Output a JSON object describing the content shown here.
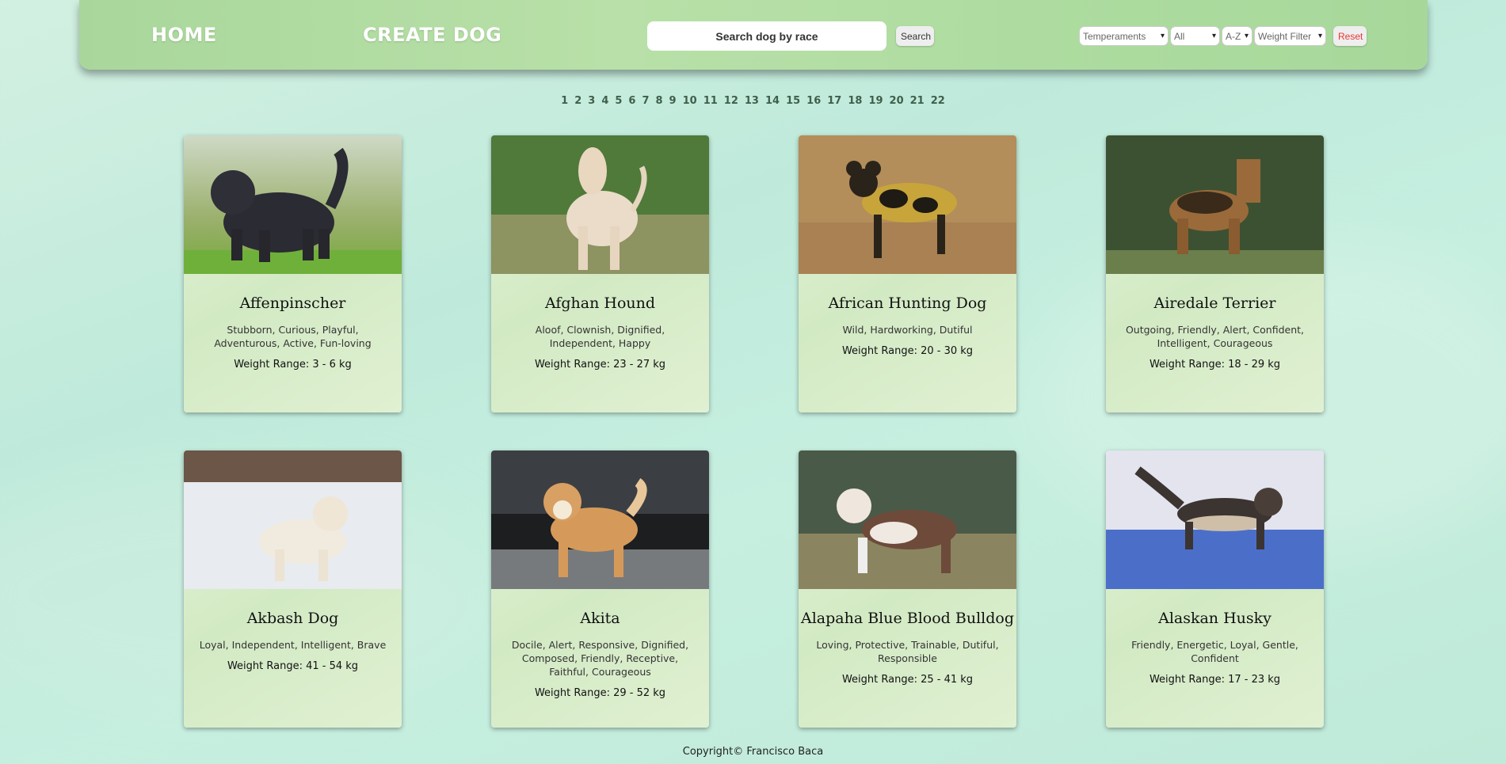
{
  "nav": {
    "home_label": "HOME",
    "create_label": "CREATE DOG",
    "search_placeholder": "Search dog by race",
    "search_button": "Search",
    "filters": {
      "temperaments": "Temperaments",
      "origin": "All",
      "order": "A-Z",
      "weight": "Weight Filter"
    },
    "reset_button": "Reset"
  },
  "pagination": [
    "1",
    "2",
    "3",
    "4",
    "5",
    "6",
    "7",
    "8",
    "9",
    "10",
    "11",
    "12",
    "13",
    "14",
    "15",
    "16",
    "17",
    "18",
    "19",
    "20",
    "21",
    "22"
  ],
  "cards": [
    {
      "name": "Affenpinscher",
      "temperaments": "Stubborn, Curious, Playful, Adventurous, Active, Fun-loving",
      "weight": "Weight Range: 3 - 6 kg",
      "photo": "black shaggy small dog on grass"
    },
    {
      "name": "Afghan Hound",
      "temperaments": "Aloof, Clownish, Dignified, Independent, Happy",
      "weight": "Weight Range: 23 - 27 kg",
      "photo": "long-haired cream hound on grass"
    },
    {
      "name": "African Hunting Dog",
      "temperaments": "Wild, Hardworking, Dutiful",
      "weight": "Weight Range: 20 - 30 kg",
      "photo": "mottled wild dog in dry grass"
    },
    {
      "name": "Airedale Terrier",
      "temperaments": "Outgoing, Friendly, Alert, Confident, Intelligent, Courageous",
      "weight": "Weight Range: 18 - 29 kg",
      "photo": "tan terrier before ivy wall"
    },
    {
      "name": "Akbash Dog",
      "temperaments": "Loyal, Independent, Intelligent, Brave",
      "weight": "Weight Range: 41 - 54 kg",
      "photo": "white dog in snow"
    },
    {
      "name": "Akita",
      "temperaments": "Docile, Alert, Responsive, Dignified, Composed, Friendly, Receptive, Faithful, Courageous",
      "weight": "Weight Range: 29 - 52 kg",
      "photo": "red akita by fence"
    },
    {
      "name": "Alapaha Blue Blood Bulldog",
      "temperaments": "Loving, Protective, Trainable, Dutiful, Responsible",
      "weight": "Weight Range: 25 - 41 kg",
      "photo": "brown white bulldog on ground"
    },
    {
      "name": "Alaskan Husky",
      "temperaments": "Friendly, Energetic, Loyal, Gentle, Confident",
      "weight": "Weight Range: 17 - 23 kg",
      "photo": "husky running in snow"
    }
  ],
  "footer": "Copyright© Francisco Baca",
  "colors": {
    "accent_navbar": "#a9d79b",
    "reset_text": "#e53935",
    "background": "#c4ecdd"
  }
}
